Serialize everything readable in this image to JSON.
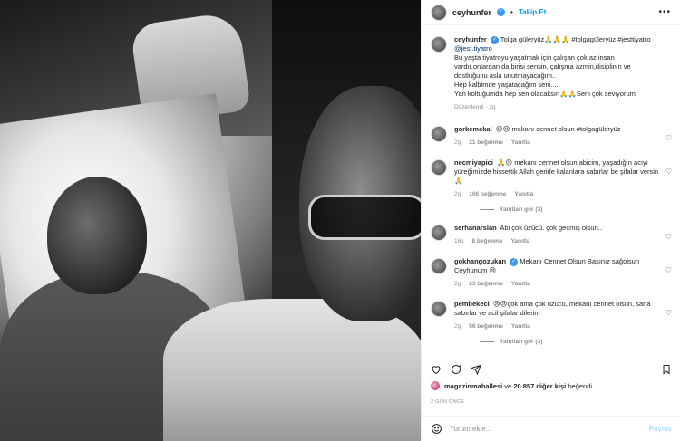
{
  "header": {
    "username": "ceyhunfer",
    "separator": "•",
    "follow_label": "Takip Et",
    "more_icon": "more-horizontal-icon"
  },
  "caption": {
    "username": "ceyhunfer",
    "lines": [
      "Tolga güleryüz🙏🙏🙏 #tolgagüleryüz #jesttiyatro",
      "@jest.tiyatro",
      "Bu yaşta tiyatroyu yaşatmak için çalışan çok az insan vardır.onlardan da birisi sensin..çalışma azmin,disiplinin ve dostluğunu asla unutmayacağım..",
      "Hep kalbimde yaşatacağım seni....",
      "Yan koltuğumda hep sen olacaksın🙏🙏Seni çok seviyorum"
    ],
    "edited": "Düzenlendi · 2g"
  },
  "comments": [
    {
      "username": "gorkemekal",
      "text": "😢😢 mekanı cennet olsun #tolgagüleryüz",
      "time": "2g",
      "likes": "21 beğenme",
      "reply": "Yanıtla"
    },
    {
      "username": "necmiyapici",
      "text": "🙏😢 mekanı cennet olsun abicim, yaşadığın acıyı yüreğimizde hissettik Allah geride kalanlara sabırlar be şifalar versin 🙏",
      "time": "2g",
      "likes": "106 beğenme",
      "reply": "Yanıtla",
      "replies_label": "Yanıtları gör (3)"
    },
    {
      "username": "serhanarslan",
      "text": "Abi çok üzücü. çok geçmiş olsun..",
      "time": "16s",
      "likes": "8 beğenme",
      "reply": "Yanıtla"
    },
    {
      "username": "gokhangozukan",
      "text": "Mekanı Cennet Olsun Başınız sağolsun Ceyhunum 😢",
      "time": "2g",
      "likes": "23 beğenme",
      "reply": "Yanıtla"
    },
    {
      "username": "pembekeci",
      "text": "😢😢çok ama çok üzücü, mekanı cennet olsun, sana sabırlar ve acil şifalar dilerim",
      "time": "2g",
      "likes": "56 beğenme",
      "reply": "Yanıtla",
      "replies_label": "Yanıtları gör (3)"
    }
  ],
  "likes": {
    "user": "magazinmahallesi",
    "connector": "ve",
    "others": "20.857 diğer kişi",
    "suffix": "beğendi"
  },
  "post_date": "2 GÜN ÖNCE",
  "comment_input": {
    "placeholder": "Yorum ekle...",
    "post_label": "Paylaş"
  },
  "colors": {
    "accent": "#0095f6",
    "verified": "#3897f0",
    "muted": "#8e8e8e"
  }
}
